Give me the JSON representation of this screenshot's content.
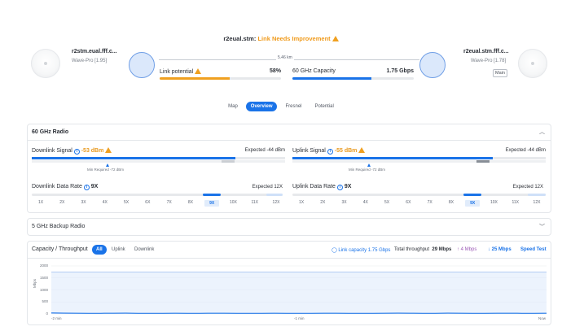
{
  "header": {
    "link_name": "r2eual.stm:",
    "link_status": "Link Needs Improvement",
    "distance": "5.46 km"
  },
  "left_device": {
    "name": "r2stm.eual.fff.c...",
    "model": "Wave-Pro [1.95]"
  },
  "right_device": {
    "name": "r2eual.stm.fff.c...",
    "model": "Wave-Pro [1.78]",
    "badge": "Main"
  },
  "link_potential": {
    "label": "Link potential",
    "value": "58%",
    "fraction": 0.58,
    "color": "#f0a020"
  },
  "capacity_60": {
    "label": "60 GHz Capacity",
    "value": "1.75 Gbps",
    "fraction": 0.65,
    "color": "#1a73e8"
  },
  "tabs": [
    "Map",
    "Overview",
    "Fresnel",
    "Potential"
  ],
  "active_tab": "Overview",
  "radio60": {
    "title": "60 GHz Radio",
    "downlink_signal": {
      "label": "Downlink Signal",
      "value": "-53 dBm",
      "expected": "Expected -44 dBm",
      "min_required": "Min Required -72 dBm"
    },
    "uplink_signal": {
      "label": "Uplink Signal",
      "value": "-55 dBm",
      "expected": "Expected -44 dBm",
      "min_required": "Min Required -72 dBm"
    },
    "downlink_rate": {
      "label": "Downlink Data Rate",
      "value": "9X",
      "expected": "Expected 12X"
    },
    "uplink_rate": {
      "label": "Uplink Data Rate",
      "value": "9X",
      "expected": "Expected 12X"
    },
    "rate_labels": [
      "1X",
      "2X",
      "3X",
      "4X",
      "5X",
      "6X",
      "7X",
      "8X",
      "9X",
      "10X",
      "11X",
      "12X"
    ],
    "selected_rate": "9X"
  },
  "backup": {
    "title": "5 GHz Backup Radio"
  },
  "capacity": {
    "title": "Capacity / Throughput",
    "segments": [
      "All",
      "Uplink",
      "Downlink"
    ],
    "active_segment": "All",
    "link_capacity": "Link capacity 1.75 Gbps",
    "total_label": "Total throughput",
    "total_value": "29 Mbps",
    "up_value": "4 Mbps",
    "down_value": "25 Mbps",
    "speed_test": "Speed Test"
  },
  "colors": {
    "accent": "#1a73e8",
    "warning": "#f0a020",
    "upload": "#9b59b6"
  },
  "chart_data": {
    "type": "area",
    "ylabel": "Mbps",
    "ylim": [
      0,
      2000
    ],
    "yticks": [
      "2000",
      "1500",
      "1000",
      "500",
      "0"
    ],
    "xticks": [
      "-2 min",
      "-1 min",
      "Now"
    ],
    "series": [
      {
        "name": "Link capacity",
        "values": [
          1750,
          1750,
          1750,
          1750,
          1750,
          1750,
          1750,
          1750,
          1750,
          1750,
          1750,
          1750,
          1750,
          1750,
          1750,
          1750,
          1750,
          1750,
          1750,
          1750,
          1750,
          1750,
          1750,
          1750,
          1750,
          1750,
          1750,
          1750,
          1750,
          1750,
          1750,
          1750,
          1750,
          1750,
          1750,
          1750,
          1750,
          1750,
          1750,
          1750,
          1750
        ]
      },
      {
        "name": "Throughput",
        "values": [
          40,
          35,
          30,
          28,
          26,
          30,
          33,
          28,
          25,
          27,
          30,
          26,
          24,
          29,
          31,
          27,
          25,
          28,
          30,
          26,
          23,
          27,
          29,
          31,
          28,
          25,
          27,
          30,
          33,
          29,
          26,
          28,
          35,
          30,
          27,
          24,
          29,
          31,
          28,
          26,
          29
        ]
      }
    ]
  }
}
